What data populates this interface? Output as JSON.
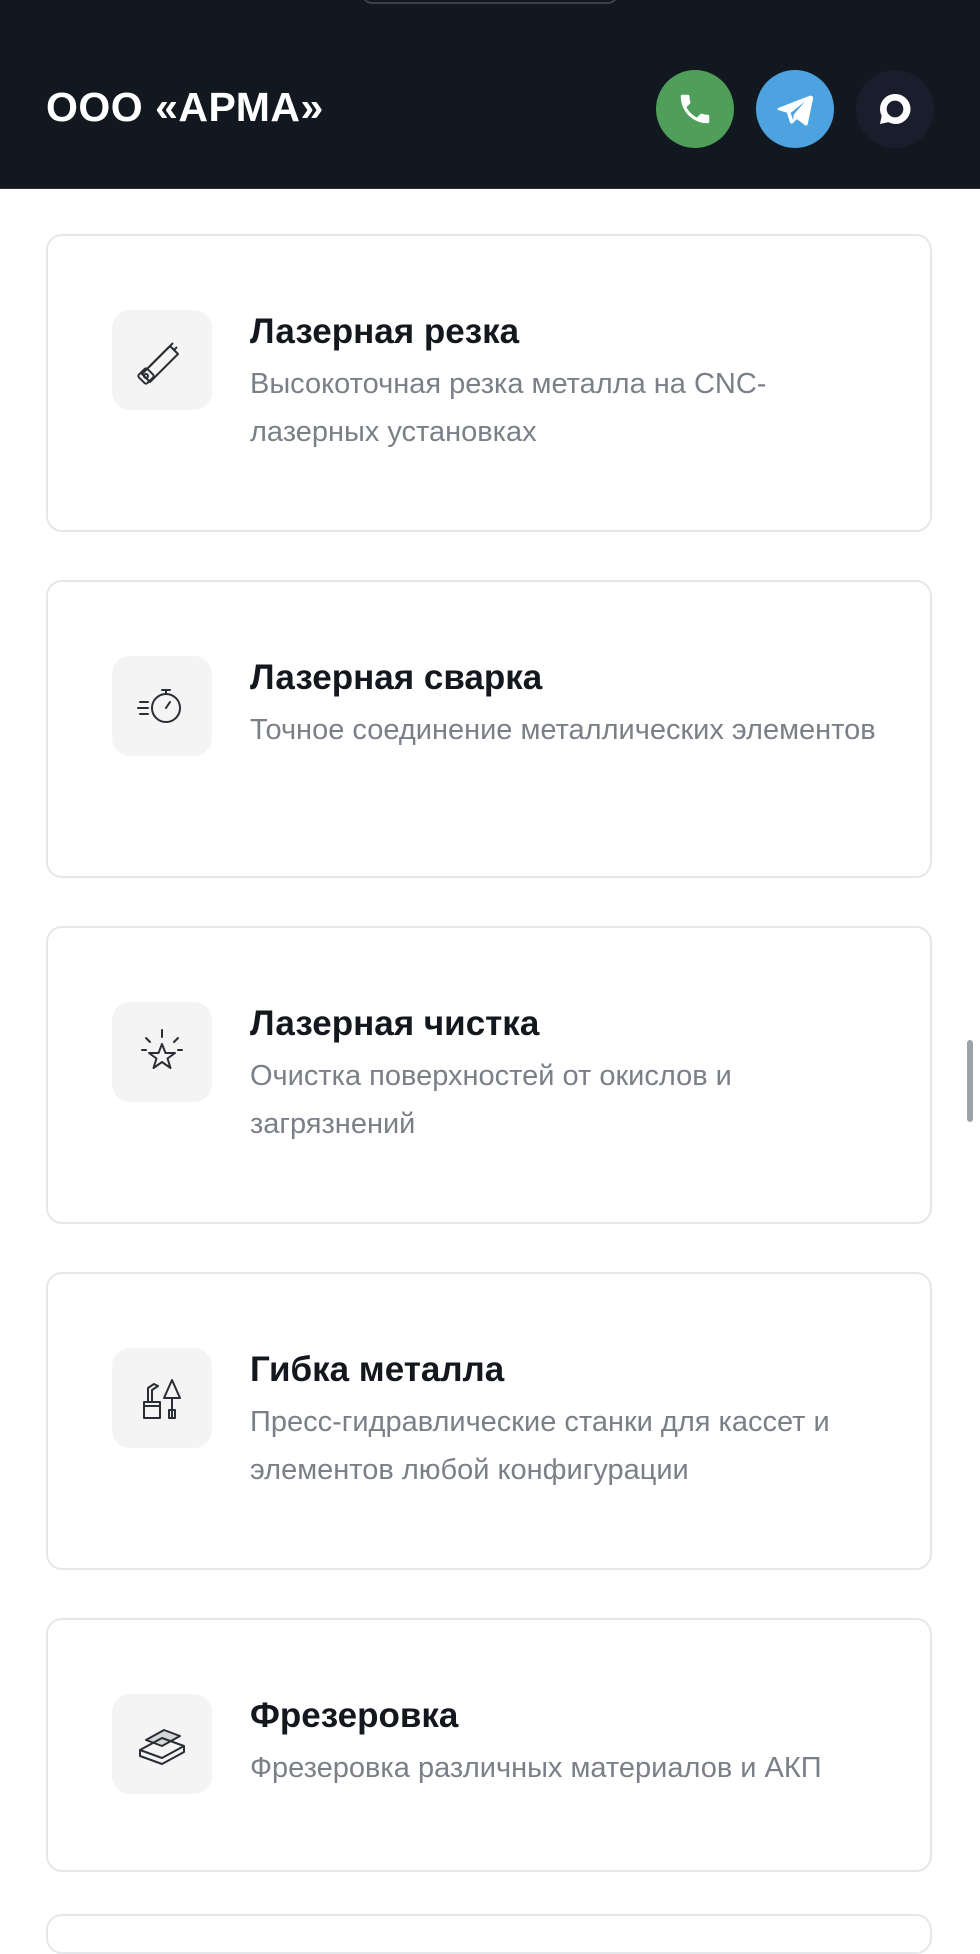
{
  "header": {
    "brand": "ООО «АРМА»",
    "contact_buttons": [
      {
        "icon": "phone-icon",
        "color": "#4f9e59"
      },
      {
        "icon": "telegram-icon",
        "color": "#4da3e0"
      },
      {
        "icon": "chat-icon",
        "color": "#1a1e2c"
      }
    ]
  },
  "services": [
    {
      "icon": "saw-icon",
      "title": "Лазерная резка",
      "description": "Высокоточная резка металла на CNC-лазерных установках"
    },
    {
      "icon": "stopwatch-icon",
      "title": "Лазерная сварка",
      "description": "Точное соединение металлических элементов"
    },
    {
      "icon": "star-icon",
      "title": "Лазерная чистка",
      "description": "Очистка поверхностей от окислов и загрязнений"
    },
    {
      "icon": "paint-tools-icon",
      "title": "Гибка металла",
      "description": "Пресс-гидравлические станки для кассет и элементов любой конфигурации"
    },
    {
      "icon": "layers-icon",
      "title": "Фрезеровка",
      "description": "Фрезеровка различных материалов и АКП"
    }
  ]
}
